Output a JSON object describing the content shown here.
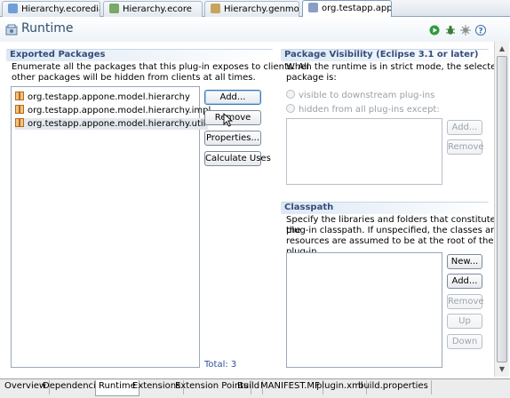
{
  "editor_tabs": [
    {
      "label": "Hierarchy.ecorediag",
      "color": "#6f9fd8"
    },
    {
      "label": "Hierarchy.ecore",
      "color": "#7aa866"
    },
    {
      "label": "Hierarchy.genmodel",
      "color": "#c9a35c"
    },
    {
      "label": "org.testapp.appone",
      "color": "#8a9fc3"
    }
  ],
  "header": {
    "title": "Runtime"
  },
  "exported": {
    "title": "Exported Packages",
    "description_line1": "Enumerate all the packages that this plug-in exposes to clients.  All",
    "description_line2": "other packages will be hidden from clients at all times.",
    "packages": [
      "org.testapp.appone.model.hierarchy",
      "org.testapp.appone.model.hierarchy.impl",
      "org.testapp.appone.model.hierarchy.util"
    ],
    "buttons": {
      "add": "Add...",
      "remove": "Remove",
      "properties": "Properties...",
      "calculate": "Calculate Uses"
    },
    "total": "Total: 3"
  },
  "visibility": {
    "title": "Package Visibility (Eclipse 3.1 or later)",
    "description_line1": "When the runtime is in strict mode, the selected",
    "description_line2": "package is:",
    "radio1": "visible to downstream plug-ins",
    "radio2": "hidden from all plug-ins except:",
    "add": "Add...",
    "remove": "Remove"
  },
  "classpath": {
    "title": "Classpath",
    "description_line1": "Specify the libraries and folders that constitute the",
    "description_line2": "plug-in classpath.  If unspecified, the classes and",
    "description_line3": "resources are assumed to be at the root of the plug-in.",
    "new": "New...",
    "add": "Add...",
    "remove": "Remove",
    "up": "Up",
    "down": "Down"
  },
  "bottom_tabs": [
    "Overview",
    "Dependencies",
    "Runtime",
    "Extensions",
    "Extension Points",
    "Build",
    "MANIFEST.MF",
    "plugin.xml",
    "build.properties"
  ],
  "colors": {
    "title": "#30506e",
    "section": "#334d7a",
    "total": "#2f4f9f"
  }
}
